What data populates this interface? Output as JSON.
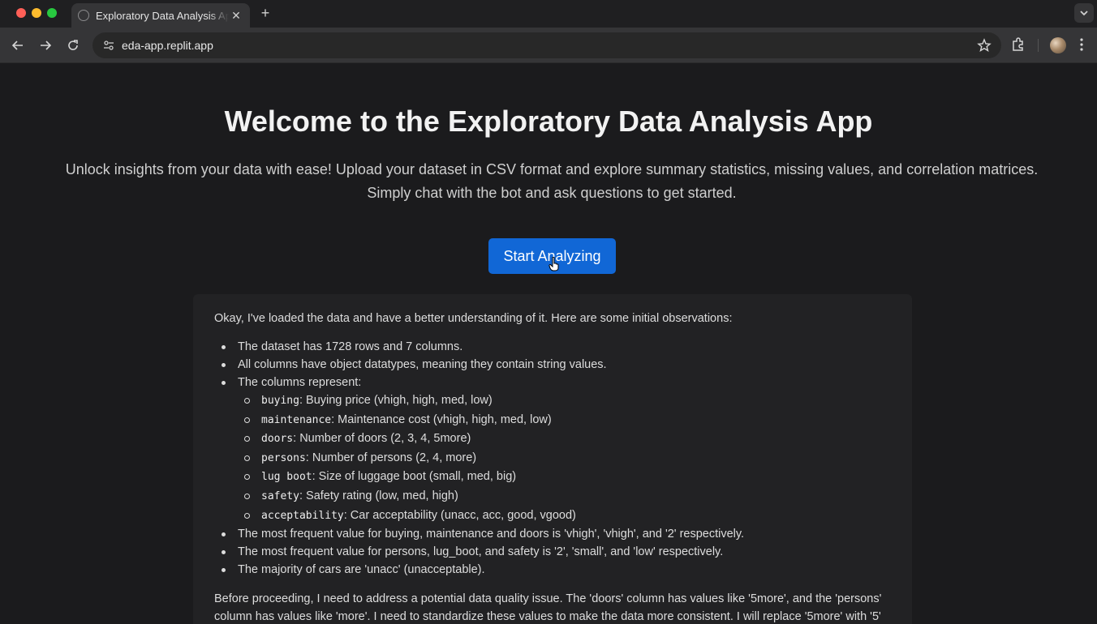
{
  "browser": {
    "tab_title": "Exploratory Data Analysis App",
    "url": "eda-app.replit.app",
    "icons": [
      "back-icon",
      "forward-icon",
      "reload-icon",
      "site-info-icon",
      "bookmark-star-icon",
      "extensions-icon",
      "profile-avatar",
      "menu-kebab-icon",
      "new-tab-icon",
      "tab-close-icon",
      "tab-search-icon"
    ]
  },
  "hero": {
    "title": "Welcome to the Exploratory Data Analysis App",
    "subtitle": "Unlock insights from your data with ease! Upload your dataset in CSV format and explore summary statistics, missing values, and correlation matrices. Simply chat with the bot and ask questions to get started.",
    "button_label": "Start Analyzing",
    "button_color": "#1167d6"
  },
  "response": {
    "intro": "Okay, I've loaded the data and have a better understanding of it. Here are some initial observations:",
    "bullet_1": "The dataset has 1728 rows and 7 columns.",
    "bullet_2": "All columns have object datatypes, meaning they contain string values.",
    "bullet_3": "The columns represent:",
    "columns": [
      {
        "name": "buying",
        "desc": ": Buying price (vhigh, high, med, low)"
      },
      {
        "name": "maintenance",
        "desc": ": Maintenance cost (vhigh, high, med, low)"
      },
      {
        "name": "doors",
        "desc": ": Number of doors (2, 3, 4, 5more)"
      },
      {
        "name": "persons",
        "desc": ": Number of persons (2, 4, more)"
      },
      {
        "name": "lug boot",
        "desc": ": Size of luggage boot (small, med, big)"
      },
      {
        "name": "safety",
        "desc": ": Safety rating (low, med, high)"
      },
      {
        "name": "acceptability",
        "desc": ": Car acceptability (unacc, acc, good, vgood)"
      }
    ],
    "bullet_4": "The most frequent value for buying, maintenance and doors is 'vhigh', 'vhigh', and '2' respectively.",
    "bullet_5": "The most frequent value for persons, lug_boot, and safety is '2', 'small', and 'low' respectively.",
    "bullet_6": "The majority of cars are 'unacc' (unacceptable).",
    "outro": "Before proceeding, I need to address a potential data quality issue. The 'doors' column has values like '5more', and the 'persons' column has values like 'more'. I need to standardize these values to make the data more consistent. I will replace '5more' with '5'"
  }
}
